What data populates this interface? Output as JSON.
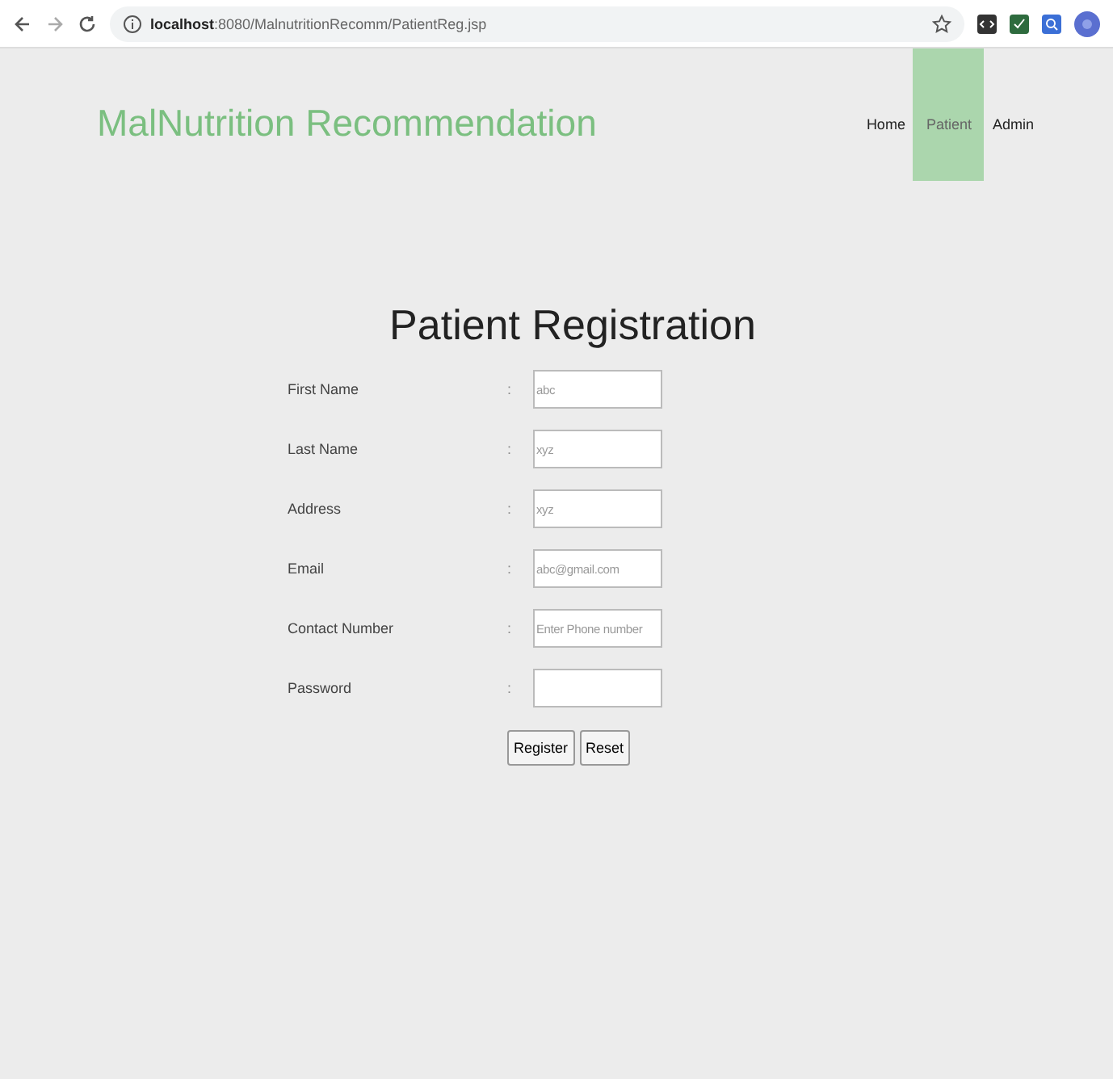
{
  "browser": {
    "url_host": "localhost",
    "url_path": ":8080/MalnutritionRecomm/PatientReg.jsp"
  },
  "site_title": "MalNutrition Recommendation",
  "nav": [
    {
      "label": "Home",
      "selected": false
    },
    {
      "label": "Patient",
      "selected": true
    },
    {
      "label": "Admin",
      "selected": false
    }
  ],
  "heading": "Patient Registration",
  "fields": [
    {
      "label": "First Name",
      "separator": ":",
      "placeholder": "abc"
    },
    {
      "label": "Last Name",
      "separator": ":",
      "placeholder": "xyz"
    },
    {
      "label": "Address",
      "separator": ":",
      "placeholder": "xyz"
    },
    {
      "label": "Email",
      "separator": ":",
      "placeholder": "abc@gmail.com"
    },
    {
      "label": "Contact Number",
      "separator": ":",
      "placeholder": "Enter Phone number"
    },
    {
      "label": "Password",
      "separator": ":"
    }
  ],
  "buttons": [
    "Register",
    "Reset"
  ]
}
